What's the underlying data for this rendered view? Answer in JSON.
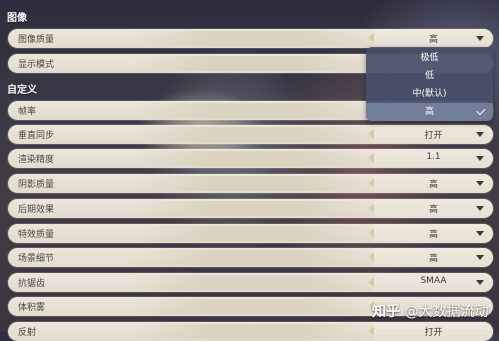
{
  "sections": {
    "image": "图像",
    "custom": "自定义"
  },
  "rows": {
    "image_quality": {
      "label": "图像质量",
      "value": "高"
    },
    "display_mode": {
      "label": "显示模式",
      "value": ""
    },
    "frame_rate": {
      "label": "帧率",
      "value": ""
    },
    "vsync": {
      "label": "垂直同步",
      "value": "打开"
    },
    "render_precision": {
      "label": "渲染精度",
      "value": "1.1"
    },
    "shadow_quality": {
      "label": "阴影质量",
      "value": "高"
    },
    "post_effects": {
      "label": "后期效果",
      "value": "高"
    },
    "effects_quality": {
      "label": "特效质量",
      "value": "高"
    },
    "scene_detail": {
      "label": "场景细节",
      "value": "高"
    },
    "anti_aliasing": {
      "label": "抗锯齿",
      "value": "SMAA"
    },
    "volumetric_fog": {
      "label": "体积雾",
      "value": ""
    },
    "reflection": {
      "label": "反射",
      "value": "打开"
    }
  },
  "dropdown": {
    "options": [
      "极低",
      "低",
      "中(默认)",
      "高"
    ],
    "selected": "高",
    "check_icon": "check-icon"
  },
  "watermark": {
    "logo": "知乎",
    "at": "@",
    "account": "大数据流动"
  }
}
